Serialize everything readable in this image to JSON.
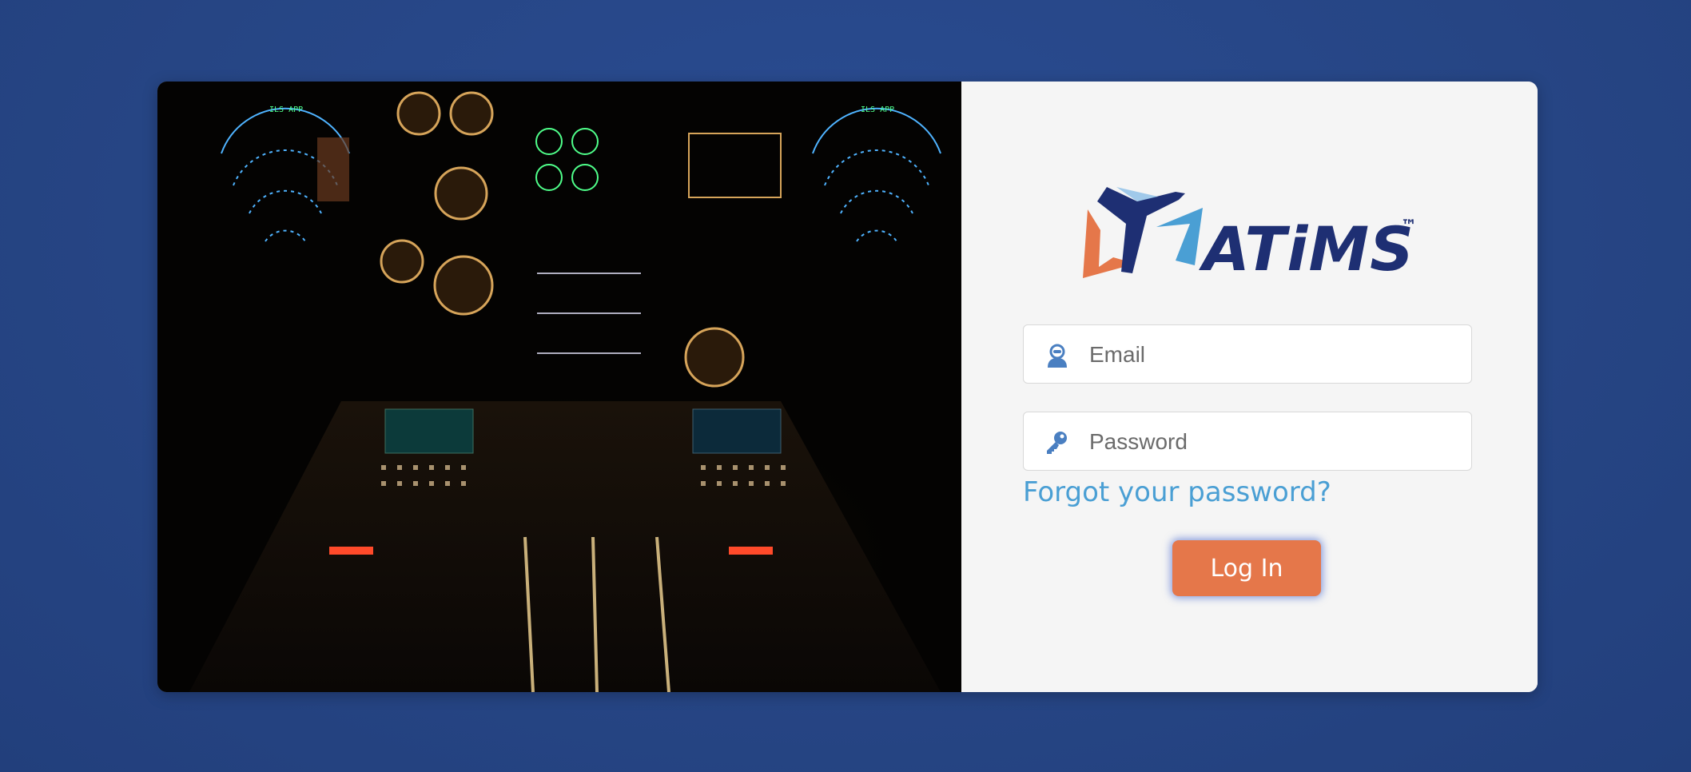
{
  "hero": {
    "image": "aircraft-cockpit-at-night"
  },
  "brand": {
    "name": "ATiMS",
    "tm": "™",
    "colors": {
      "navy": "#1e2f73",
      "orange": "#e5774a",
      "light_blue": "#4a9fd4"
    }
  },
  "login": {
    "email_placeholder": "Email",
    "password_placeholder": "Password",
    "forgot_label": "Forgot your password?",
    "submit_label": "Log In"
  },
  "icons": {
    "email": "user-icon",
    "password": "key-icon"
  }
}
